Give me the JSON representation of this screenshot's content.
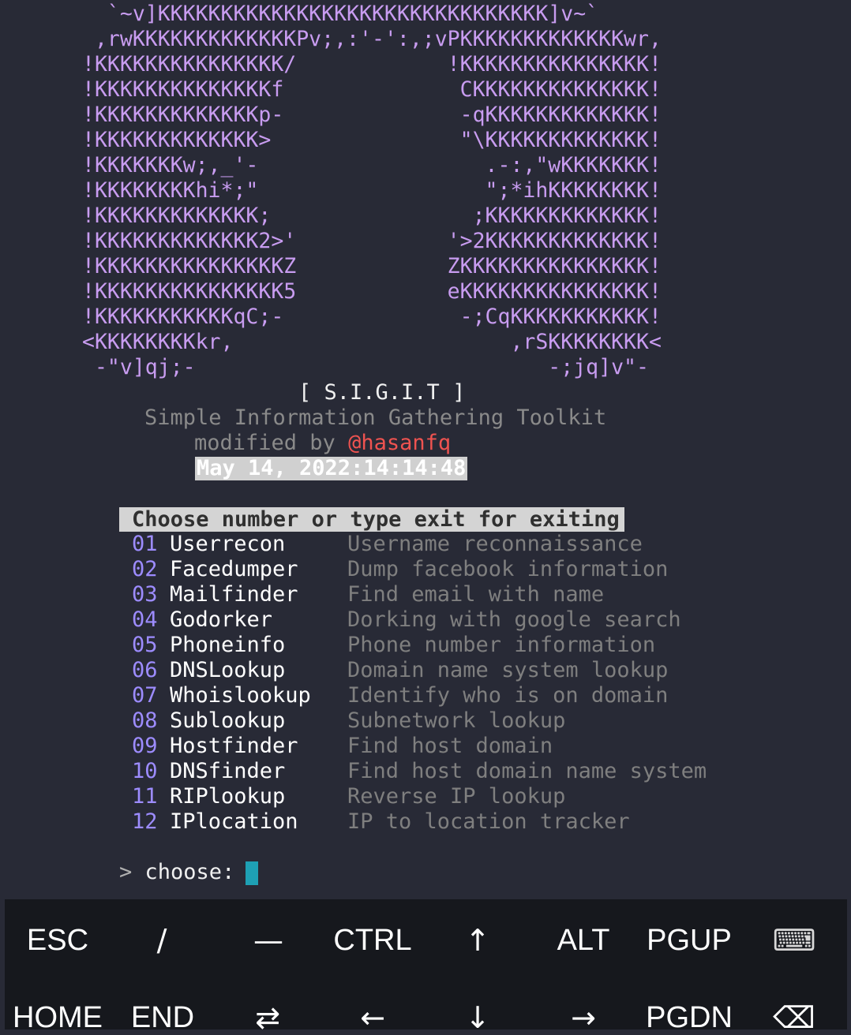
{
  "ascii_art": [
    "  `~v]KKKKKKKKKKKKKKKKKKKKKKKKKKKKKKK]v~`",
    " ,rwKKKKKKKKKKKKKPv;,:'-':,;vPKKKKKKKKKKKKKwr,",
    "!KKKKKKKKKKKKKKK/            !KKKKKKKKKKKKKKK!",
    "!KKKKKKKKKKKKKKf              CKKKKKKKKKKKKKK!",
    "!KKKKKKKKKKKKKp-              -qKKKKKKKKKKKKK!",
    "!KKKKKKKKKKKKK>               \"\\KKKKKKKKKKKKK!",
    "!KKKKKKKw;,_'-                  .-:,\"wKKKKKKK!",
    "!KKKKKKKKhi*;\"                  \";*ihKKKKKKKK!",
    "!KKKKKKKKKKKKK;                ;KKKKKKKKKKKKK!",
    "!KKKKKKKKKKKKK2>'            '>2KKKKKKKKKKKKK!",
    "!KKKKKKKKKKKKKKKZ            ZKKKKKKKKKKKKKKK!",
    "!KKKKKKKKKKKKKKK5            eKKKKKKKKKKKKKKK!",
    "!KKKKKKKKKKKqC;-              -;CqKKKKKKKKKKK!",
    "<KKKKKKKKkr,                      ,rSKKKKKKKK<",
    " -\"v]qj;-                            -;jq]v\"-"
  ],
  "header": {
    "title": "[ S.I.G.I.T ]",
    "subtitle": "Simple Information Gathering Toolkit",
    "modified_by": "modified by ",
    "author": "@hasanfq",
    "datetime": "May 14, 2022:14:14:48"
  },
  "menu": {
    "prompt": "Choose number or type exit for exiting",
    "items": [
      {
        "num": "01",
        "name": "Userrecon",
        "desc": "Username reconnaissance"
      },
      {
        "num": "02",
        "name": "Facedumper",
        "desc": "Dump facebook information"
      },
      {
        "num": "03",
        "name": "Mailfinder",
        "desc": "Find email with name"
      },
      {
        "num": "04",
        "name": "Godorker",
        "desc": "Dorking with google search"
      },
      {
        "num": "05",
        "name": "Phoneinfo",
        "desc": "Phone number information"
      },
      {
        "num": "06",
        "name": "DNSLookup",
        "desc": "Domain name system lookup"
      },
      {
        "num": "07",
        "name": "Whoislookup",
        "desc": "Identify who is on domain"
      },
      {
        "num": "08",
        "name": "Sublookup",
        "desc": "Subnetwork lookup"
      },
      {
        "num": "09",
        "name": "Hostfinder",
        "desc": "Find host domain"
      },
      {
        "num": "10",
        "name": "DNSfinder",
        "desc": "Find host domain name system"
      },
      {
        "num": "11",
        "name": "RIPlookup",
        "desc": "Reverse IP lookup"
      },
      {
        "num": "12",
        "name": "IPlocation",
        "desc": "IP to location tracker"
      }
    ]
  },
  "input": {
    "prompt_symbol": ">",
    "label": "choose:"
  },
  "keys": {
    "row1": [
      "ESC",
      "/",
      "—",
      "CTRL",
      "↑",
      "ALT",
      "PGUP",
      "⌨"
    ],
    "row2": [
      "HOME",
      "END",
      "⇄",
      "←",
      "↓",
      "→",
      "PGDN",
      "⌫"
    ]
  },
  "colors": {
    "background": "#282a36",
    "ascii": "#c89cf0",
    "author": "#ef5350",
    "number": "#9d8cff",
    "cursor": "#1ea0b4"
  }
}
